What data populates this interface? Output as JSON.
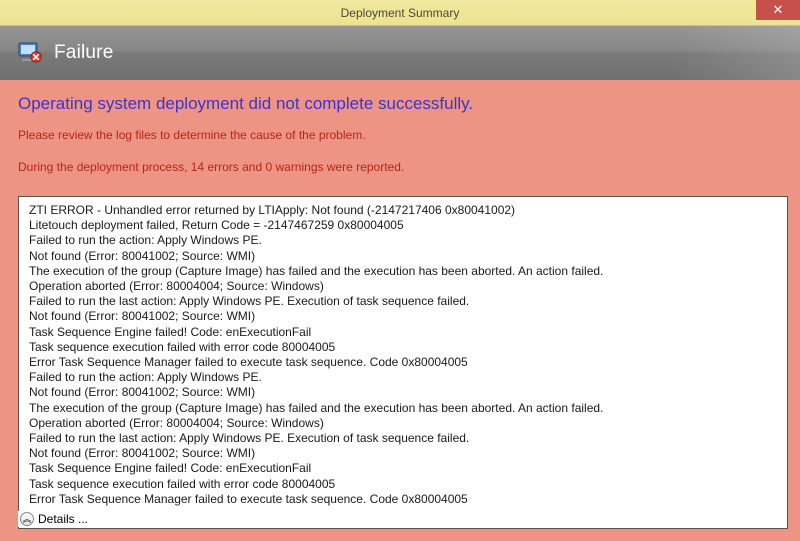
{
  "window": {
    "title": "Deployment Summary",
    "close_label": "✕"
  },
  "header": {
    "status_text": "Failure"
  },
  "main": {
    "headline": "Operating system deployment did not complete successfully.",
    "subline": "Please review the log files to determine the cause of the problem.",
    "summary_line": "During the deployment process, 14 errors and 0 warnings were reported.",
    "details_label": "Details ...",
    "expander_glyph": "︽"
  },
  "log": {
    "lines": [
      "ZTI ERROR - Unhandled error returned by LTIApply: Not found  (-2147217406  0x80041002)",
      "Litetouch deployment failed, Return Code = -2147467259  0x80004005",
      "Failed to run the action: Apply Windows PE.",
      "Not found (Error: 80041002; Source: WMI)",
      "The execution of the group (Capture Image) has failed and the execution has been aborted. An action failed.",
      "Operation aborted (Error: 80004004; Source: Windows)",
      "Failed to run the last action: Apply Windows PE. Execution of task sequence failed.",
      "Not found (Error: 80041002; Source: WMI)",
      "Task Sequence Engine failed! Code: enExecutionFail",
      "Task sequence execution failed with error code 80004005",
      "Error Task Sequence Manager failed to execute task sequence. Code 0x80004005",
      "Failed to run the action: Apply Windows PE.",
      "Not found (Error: 80041002; Source: WMI)",
      "The execution of the group (Capture Image) has failed and the execution has been aborted. An action failed.",
      "Operation aborted (Error: 80004004; Source: Windows)",
      "Failed to run the last action: Apply Windows PE. Execution of task sequence failed.",
      "Not found (Error: 80041002; Source: WMI)",
      "Task Sequence Engine failed! Code: enExecutionFail",
      "Task sequence execution failed with error code 80004005",
      "Error Task Sequence Manager failed to execute task sequence. Code 0x80004005"
    ]
  }
}
